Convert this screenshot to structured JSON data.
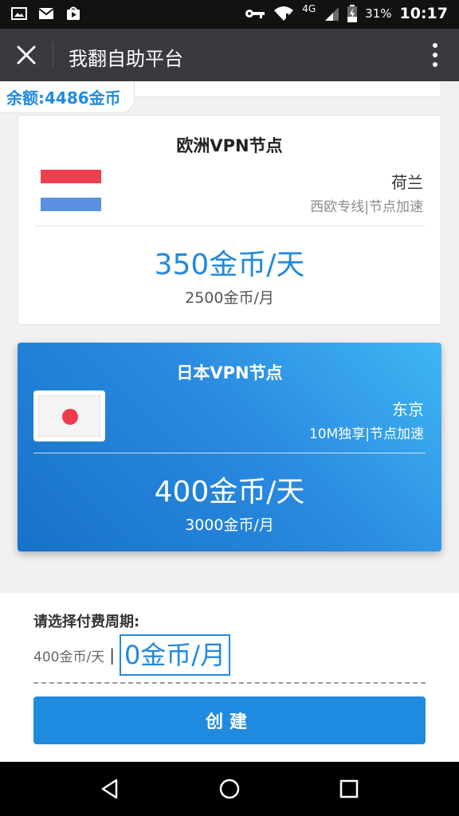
{
  "status_bar": {
    "network": "4G",
    "battery": "31%",
    "time": "10:17",
    "icons": [
      "image-icon",
      "mail-icon",
      "play-store-icon",
      "key-icon",
      "wifi-icon",
      "signal-icon",
      "battery-icon"
    ]
  },
  "app_bar": {
    "title": "我翻自助平台",
    "close_icon": "close-icon",
    "more_icon": "more-vert-icon"
  },
  "balance": {
    "label": "余额:4486金币"
  },
  "cards": [
    {
      "title": "欧洲VPN节点",
      "flag": "netherlands-flag",
      "city": "荷兰",
      "desc": "西欧专线|节点加速",
      "price_day": "350金币/天",
      "price_month": "2500金币/月",
      "selected": false
    },
    {
      "title": "日本VPN节点",
      "flag": "japan-flag",
      "city": "东京",
      "desc": "10M独享|节点加速",
      "price_day": "400金币/天",
      "price_month": "3000金币/月",
      "selected": true
    }
  ],
  "payment": {
    "label": "请选择付费周期:",
    "day_option": "400金币/天",
    "separator": "|",
    "month_option": "0金币/月",
    "create_button": "创建"
  },
  "colors": {
    "accent": "#1f8be0",
    "app_bar": "#393a3f",
    "status_bar": "#121212",
    "nl_red": "#ee3f4f",
    "nl_white": "#ffffff",
    "nl_blue": "#5b8fe0",
    "jp_red": "#ee3a4c"
  },
  "nav_bar": {
    "icons": [
      "back-icon",
      "home-icon",
      "recents-icon"
    ]
  }
}
